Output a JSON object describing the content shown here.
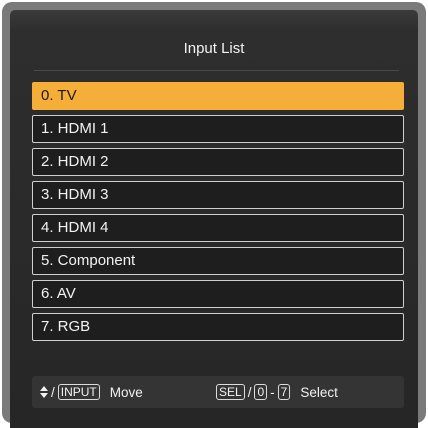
{
  "window": {
    "title": "Input List"
  },
  "inputs": [
    {
      "label": "0. TV",
      "selected": true
    },
    {
      "label": "1. HDMI 1",
      "selected": false
    },
    {
      "label": "2. HDMI 2",
      "selected": false
    },
    {
      "label": "3. HDMI 3",
      "selected": false
    },
    {
      "label": "4. HDMI 4",
      "selected": false
    },
    {
      "label": "5. Component",
      "selected": false
    },
    {
      "label": "6. AV",
      "selected": false
    },
    {
      "label": "7. RGB",
      "selected": false
    }
  ],
  "footer": {
    "move": {
      "icon": "up-down-arrows-icon",
      "separator": "/",
      "key": "INPUT",
      "action": "Move"
    },
    "select": {
      "key": "SEL",
      "separator": "/",
      "range_start": "0",
      "dash": "-",
      "range_end": "7",
      "action": "Select"
    }
  },
  "colors": {
    "highlight": "#f5ae37",
    "panel": "#262626",
    "frame": "#7a7a7a"
  }
}
